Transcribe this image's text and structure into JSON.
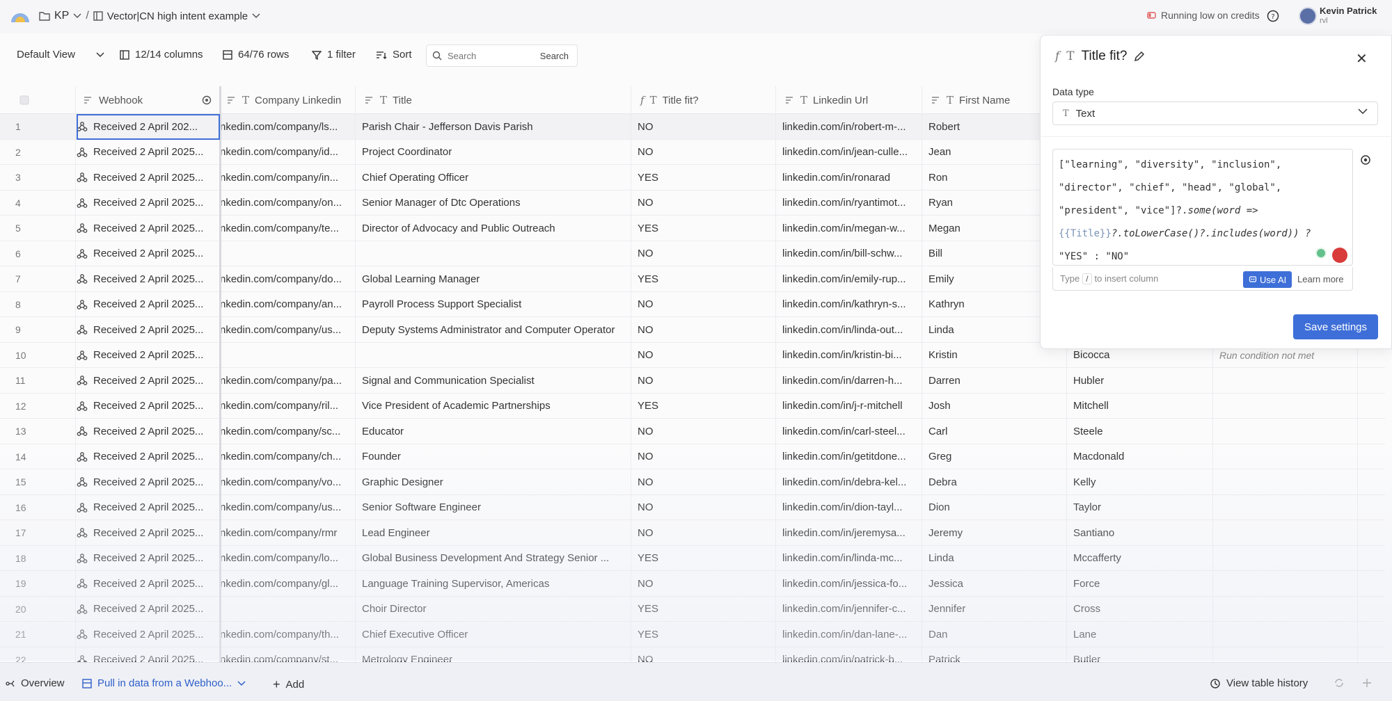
{
  "topbar": {
    "workspace": "KP",
    "table_name": "Vector|CN high intent example",
    "credits_text": "Running low on credits",
    "user_name": "Kevin Patrick",
    "user_org": "rvl"
  },
  "toolbar": {
    "view": "Default View",
    "columns": "12/14 columns",
    "rows": "64/76 rows",
    "filter": "1 filter",
    "sort": "Sort",
    "search_placeholder": "Search",
    "search_button": "Search"
  },
  "columns": {
    "webhook": "Webhook",
    "company_linkedin": "Company Linkedin",
    "title": "Title",
    "title_fit": "Title fit?",
    "linkedin_url": "Linkedin Url",
    "first_name": "First Name"
  },
  "rows": [
    {
      "n": "1",
      "wh": "Received 2 April 202...",
      "co": "nkedin.com/company/ls...",
      "ti": "Parish Chair - Jefferson Davis Parish",
      "tf": "NO",
      "li": "linkedin.com/in/robert-m-...",
      "fn": "Robert",
      "ln": "",
      "rc": ""
    },
    {
      "n": "2",
      "wh": "Received 2 April 2025...",
      "co": "nkedin.com/company/id...",
      "ti": "Project Coordinator",
      "tf": "NO",
      "li": "linkedin.com/in/jean-culle...",
      "fn": "Jean",
      "ln": "",
      "rc": ""
    },
    {
      "n": "3",
      "wh": "Received 2 April 2025...",
      "co": "nkedin.com/company/in...",
      "ti": "Chief Operating Officer",
      "tf": "YES",
      "li": "linkedin.com/in/ronarad",
      "fn": "Ron",
      "ln": "",
      "rc": ""
    },
    {
      "n": "4",
      "wh": "Received 2 April 2025...",
      "co": "nkedin.com/company/on...",
      "ti": "Senior Manager of Dtc Operations",
      "tf": "NO",
      "li": "linkedin.com/in/ryantimot...",
      "fn": "Ryan",
      "ln": "",
      "rc": ""
    },
    {
      "n": "5",
      "wh": "Received 2 April 2025...",
      "co": "nkedin.com/company/te...",
      "ti": "Director of Advocacy and Public Outreach",
      "tf": "YES",
      "li": "linkedin.com/in/megan-w...",
      "fn": "Megan",
      "ln": "",
      "rc": ""
    },
    {
      "n": "6",
      "wh": "Received 2 April 2025...",
      "co": "",
      "ti": "",
      "tf": "NO",
      "li": "linkedin.com/in/bill-schw...",
      "fn": "Bill",
      "ln": "",
      "rc": ""
    },
    {
      "n": "7",
      "wh": "Received 2 April 2025...",
      "co": "nkedin.com/company/do...",
      "ti": "Global Learning Manager",
      "tf": "YES",
      "li": "linkedin.com/in/emily-rup...",
      "fn": "Emily",
      "ln": "",
      "rc": ""
    },
    {
      "n": "8",
      "wh": "Received 2 April 2025...",
      "co": "nkedin.com/company/an...",
      "ti": "Payroll Process Support Specialist",
      "tf": "NO",
      "li": "linkedin.com/in/kathryn-s...",
      "fn": "Kathryn",
      "ln": "",
      "rc": ""
    },
    {
      "n": "9",
      "wh": "Received 2 April 2025...",
      "co": "nkedin.com/company/us...",
      "ti": "Deputy Systems Administrator and Computer Operator",
      "tf": "NO",
      "li": "linkedin.com/in/linda-out...",
      "fn": "Linda",
      "ln": "",
      "rc": ""
    },
    {
      "n": "10",
      "wh": "Received 2 April 2025...",
      "co": "",
      "ti": "",
      "tf": "NO",
      "li": "linkedin.com/in/kristin-bi...",
      "fn": "Kristin",
      "ln": "Bicocca",
      "rc": "Run condition not met"
    },
    {
      "n": "11",
      "wh": "Received 2 April 2025...",
      "co": "nkedin.com/company/pa...",
      "ti": "Signal and Communication Specialist",
      "tf": "NO",
      "li": "linkedin.com/in/darren-h...",
      "fn": "Darren",
      "ln": "Hubler",
      "rc": ""
    },
    {
      "n": "12",
      "wh": "Received 2 April 2025...",
      "co": "nkedin.com/company/ril...",
      "ti": "Vice President of Academic Partnerships",
      "tf": "YES",
      "li": "linkedin.com/in/j-r-mitchell",
      "fn": "Josh",
      "ln": "Mitchell",
      "rc": ""
    },
    {
      "n": "13",
      "wh": "Received 2 April 2025...",
      "co": "nkedin.com/company/sc...",
      "ti": "Educator",
      "tf": "NO",
      "li": "linkedin.com/in/carl-steel...",
      "fn": "Carl",
      "ln": "Steele",
      "rc": ""
    },
    {
      "n": "14",
      "wh": "Received 2 April 2025...",
      "co": "nkedin.com/company/ch...",
      "ti": "Founder",
      "tf": "NO",
      "li": "linkedin.com/in/getitdone...",
      "fn": "Greg",
      "ln": "Macdonald",
      "rc": ""
    },
    {
      "n": "15",
      "wh": "Received 2 April 2025...",
      "co": "nkedin.com/company/vo...",
      "ti": "Graphic Designer",
      "tf": "NO",
      "li": "linkedin.com/in/debra-kel...",
      "fn": "Debra",
      "ln": "Kelly",
      "rc": ""
    },
    {
      "n": "16",
      "wh": "Received 2 April 2025...",
      "co": "nkedin.com/company/us...",
      "ti": "Senior Software Engineer",
      "tf": "NO",
      "li": "linkedin.com/in/dion-tayl...",
      "fn": "Dion",
      "ln": "Taylor",
      "rc": ""
    },
    {
      "n": "17",
      "wh": "Received 2 April 2025...",
      "co": "nkedin.com/company/rmr",
      "ti": "Lead Engineer",
      "tf": "NO",
      "li": "linkedin.com/in/jeremysa...",
      "fn": "Jeremy",
      "ln": "Santiano",
      "rc": ""
    },
    {
      "n": "18",
      "wh": "Received 2 April 2025...",
      "co": "nkedin.com/company/lo...",
      "ti": "Global Business Development And Strategy Senior ...",
      "tf": "YES",
      "li": "linkedin.com/in/linda-mc...",
      "fn": "Linda",
      "ln": "Mccafferty",
      "rc": ""
    },
    {
      "n": "19",
      "wh": "Received 2 April 2025...",
      "co": "nkedin.com/company/gl...",
      "ti": "Language Training Supervisor, Americas",
      "tf": "NO",
      "li": "linkedin.com/in/jessica-fo...",
      "fn": "Jessica",
      "ln": "Force",
      "rc": ""
    },
    {
      "n": "20",
      "wh": "Received 2 April 2025...",
      "co": "",
      "ti": "Choir Director",
      "tf": "YES",
      "li": "linkedin.com/in/jennifer-c...",
      "fn": "Jennifer",
      "ln": "Cross",
      "rc": ""
    },
    {
      "n": "21",
      "wh": "Received 2 April 2025...",
      "co": "nkedin.com/company/th...",
      "ti": "Chief Executive Officer",
      "tf": "YES",
      "li": "linkedin.com/in/dan-lane-...",
      "fn": "Dan",
      "ln": "Lane",
      "rc": ""
    },
    {
      "n": "22",
      "wh": "Received 2 April 2025...",
      "co": "nkedin.com/company/st...",
      "ti": "Metrology Engineer",
      "tf": "NO",
      "li": "linkedin.com/in/patrick-b...",
      "fn": "Patrick",
      "ln": "Butler",
      "rc": ""
    }
  ],
  "panel": {
    "title": "Title fit?",
    "data_type_label": "Data type",
    "data_type_value": "Text",
    "code_line1": "[\"learning\", \"diversity\", \"inclusion\",",
    "code_line2": "\"director\", \"chief\", \"head\", \"global\",",
    "code_line3_a": "\"president\", \"vice\"]?.",
    "code_line3_b": "some(word =>",
    "code_line4_a": "{{Title}}",
    "code_line4_b": "?.toLowerCase()?.includes(word)) ?",
    "code_line5": "\"YES\" : \"NO\"",
    "hint_type": "Type",
    "hint_key": "/",
    "hint_rest": "to insert column",
    "use_ai": "Use AI",
    "learn_more": "Learn more",
    "save": "Save settings"
  },
  "bottombar": {
    "overview": "Overview",
    "active_tab": "Pull in data from a Webhoo...",
    "add": "Add",
    "history": "View table history"
  }
}
